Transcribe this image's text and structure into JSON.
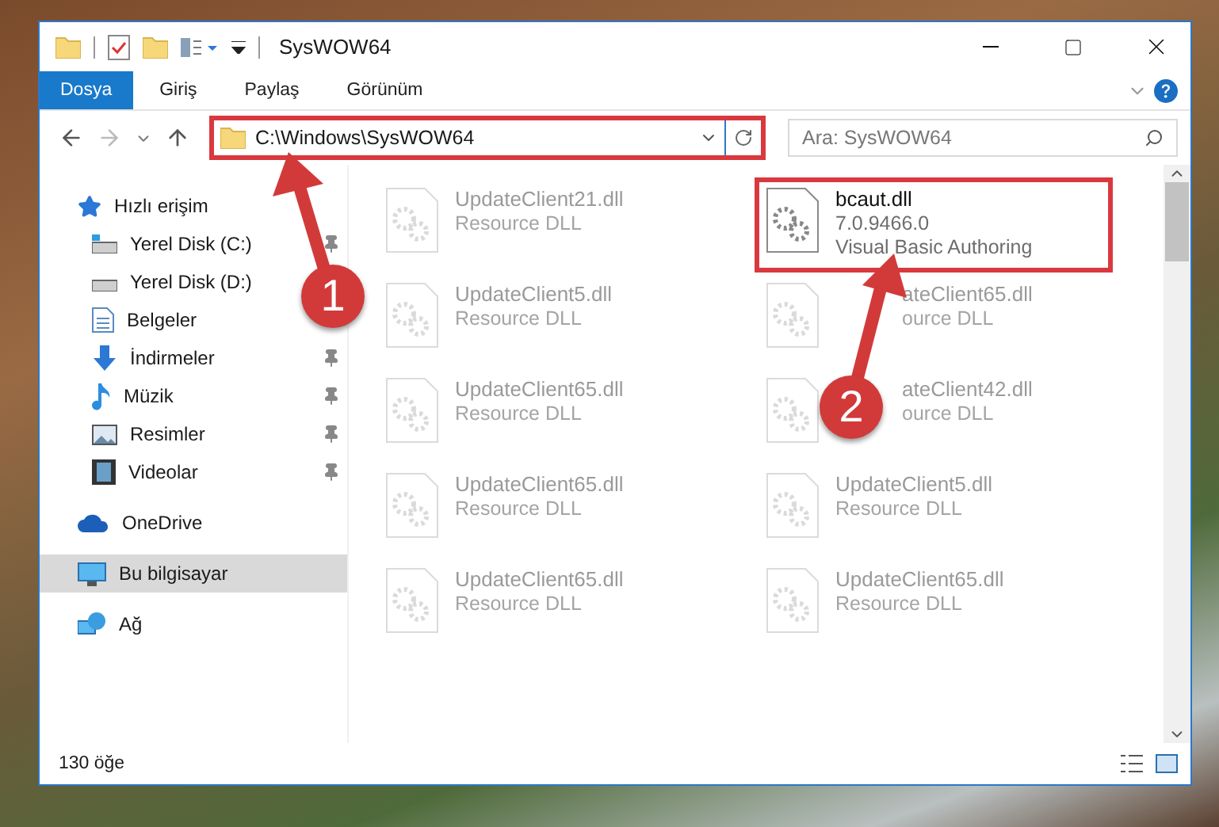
{
  "window": {
    "title": "SysWOW64"
  },
  "ribbon_tabs": [
    {
      "label": "Dosya",
      "kind": "file"
    },
    {
      "label": "Giriş",
      "kind": "tab"
    },
    {
      "label": "Paylaş",
      "kind": "tab"
    },
    {
      "label": "Görünüm",
      "kind": "tab"
    }
  ],
  "address_bar": {
    "path": "C:\\Windows\\SysWOW64",
    "highlighted": true
  },
  "search": {
    "placeholder": "Ara: SysWOW64"
  },
  "sidebar": {
    "items": [
      {
        "label": "Hızlı erişim",
        "kind": "quick",
        "selected": false,
        "children": [
          {
            "label": "Yerel Disk (C:)",
            "kind": "diskc",
            "pinned": true
          },
          {
            "label": "Yerel Disk (D:)",
            "kind": "disk"
          },
          {
            "label": "Belgeler",
            "kind": "docs"
          },
          {
            "label": "İndirmeler",
            "kind": "downloads",
            "pinned": true
          },
          {
            "label": "Müzik",
            "kind": "music",
            "pinned": true
          },
          {
            "label": "Resimler",
            "kind": "pictures",
            "pinned": true
          },
          {
            "label": "Videolar",
            "kind": "videos",
            "pinned": true
          }
        ]
      },
      {
        "label": "OneDrive",
        "kind": "cloud",
        "selected": false
      },
      {
        "label": "Bu bilgisayar",
        "kind": "pc",
        "selected": true
      },
      {
        "label": "Ağ",
        "kind": "network",
        "selected": false
      }
    ]
  },
  "files": [
    {
      "name": "UpdateClient21.dll",
      "details": [
        "Resource DLL"
      ],
      "blurred": true,
      "highlighted": false
    },
    {
      "name": "bcaut.dll",
      "details": [
        "7.0.9466.0",
        "Visual Basic Authoring"
      ],
      "blurred": false,
      "highlighted": true
    },
    {
      "name": "UpdateClient5.dll",
      "details": [
        "Resource DLL"
      ],
      "blurred": true,
      "highlighted": false
    },
    {
      "name": "ateClient65.dll",
      "details": [
        "ource DLL"
      ],
      "blurred": true,
      "highlighted": false,
      "kind": "covered"
    },
    {
      "name": "UpdateClient65.dll",
      "details": [
        "Resource DLL"
      ],
      "blurred": true,
      "highlighted": false
    },
    {
      "name": "ateClient42.dll",
      "details": [
        "ource DLL"
      ],
      "blurred": true,
      "highlighted": false,
      "kind": "covered"
    },
    {
      "name": "UpdateClient65.dll",
      "details": [
        "Resource DLL"
      ],
      "blurred": true,
      "highlighted": false
    },
    {
      "name": "UpdateClient5.dll",
      "details": [
        "Resource DLL"
      ],
      "blurred": true,
      "highlighted": false
    },
    {
      "name": "UpdateClient65.dll",
      "details": [
        "Resource DLL"
      ],
      "blurred": true,
      "highlighted": false
    },
    {
      "name": "UpdateClient65.dll",
      "details": [
        "Resource DLL"
      ],
      "blurred": true,
      "highlighted": false
    }
  ],
  "status_bar": {
    "count": "130 öğe"
  },
  "annotations": [
    {
      "label": "1"
    },
    {
      "label": "2"
    }
  ]
}
